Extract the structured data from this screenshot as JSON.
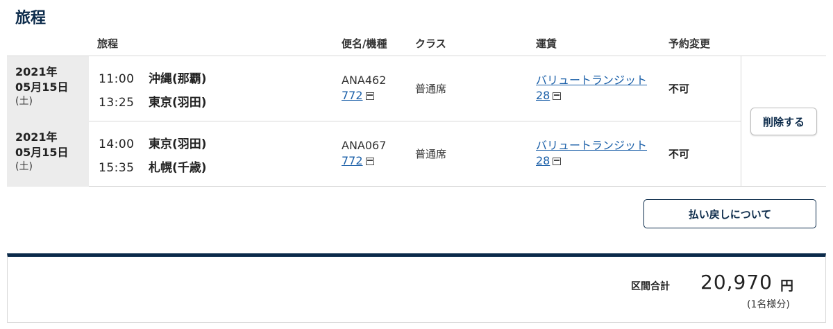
{
  "section_title": "旅程",
  "headers": {
    "itinerary": "旅程",
    "flight": "便名/機種",
    "class": "クラス",
    "fare": "運賃",
    "change": "予約変更"
  },
  "rows": [
    {
      "date_year": "2021年",
      "date_md": "05月15日",
      "date_dow": "(土)",
      "dep_time": "11:00",
      "dep_airport": "沖縄(那覇)",
      "arr_time": "13:25",
      "arr_airport": "東京(羽田)",
      "flight_no": "ANA462",
      "aircraft": "772",
      "class": "普通席",
      "fare_name": "バリュートランジット",
      "fare_code": "28",
      "change": "不可"
    },
    {
      "date_year": "2021年",
      "date_md": "05月15日",
      "date_dow": "(土)",
      "dep_time": "14:00",
      "dep_airport": "東京(羽田)",
      "arr_time": "15:35",
      "arr_airport": "札幌(千歳)",
      "flight_no": "ANA067",
      "aircraft": "772",
      "class": "普通席",
      "fare_name": "バリュートランジット",
      "fare_code": "28",
      "change": "不可"
    }
  ],
  "delete_button": "削除する",
  "refund_button": "払い戻しについて",
  "total": {
    "label": "区間合計",
    "amount": "20,970",
    "unit": "円",
    "note": "(1名様分)"
  },
  "colors": {
    "navy": "#0b2a4a",
    "link": "#1a5fa8",
    "date_bg": "#ececec"
  }
}
